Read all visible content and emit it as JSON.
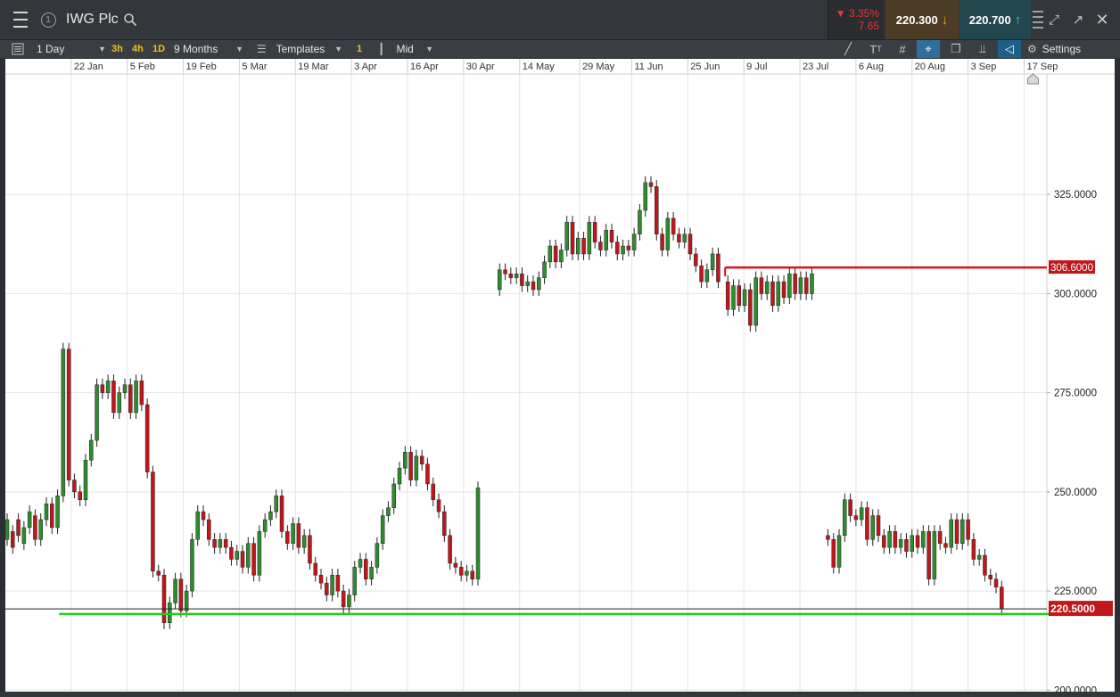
{
  "header": {
    "title": "IWG Plc",
    "change_pct": "▼ 3.35%",
    "change_abs": "7.65",
    "sell_price": "220.300",
    "buy_price": "220.700",
    "icons": [
      "menu-icon",
      "info-icon",
      "search-icon",
      "arrow-down-icon",
      "arrow-up-icon",
      "grip-icon",
      "expand-icon",
      "popout-icon",
      "close-icon"
    ]
  },
  "toolbar": {
    "interval": "1 Day",
    "timeframes": [
      "3h",
      "4h",
      "1D"
    ],
    "range": "9 Months",
    "templates": "Templates",
    "one": "1",
    "price_type": "Mid",
    "settings": "Settings"
  },
  "colors": {
    "up_candle": "#2e8b2e",
    "down_candle": "#c0171d",
    "resistance_line": "#dd1111",
    "support_line": "#22cc22",
    "price_tag": "#c0171d"
  },
  "chart_data": {
    "type": "candlestick",
    "x_tick_labels": [
      "22 Jan",
      "5 Feb",
      "19 Feb",
      "5 Mar",
      "19 Mar",
      "3 Apr",
      "16 Apr",
      "30 Apr",
      "14 May",
      "29 May",
      "11 Jun",
      "25 Jun",
      "9 Jul",
      "23 Jul",
      "6 Aug",
      "20 Aug",
      "3 Sep",
      "17 Sep"
    ],
    "y_tick_labels": [
      "325.0000",
      "300.0000",
      "275.0000",
      "250.0000",
      "225.0000",
      "200.0000"
    ],
    "y_ticks": [
      325,
      300,
      275,
      250,
      225,
      200
    ],
    "ylim": [
      194,
      350
    ],
    "grid": true,
    "horizontal_lines": [
      {
        "value": 306.6,
        "label": "306.6000",
        "color": "#dd1111",
        "from": "9 Jul"
      },
      {
        "value": 219.2,
        "color": "#22cc22",
        "from": "5 Feb"
      }
    ],
    "last_price": {
      "value": 220.5,
      "label": "220.5000"
    },
    "series": [
      {
        "name": "IWG Plc",
        "segments": [
          {
            "days": [
              [
                0,
                238,
                243
              ],
              [
                1,
                240,
                236
              ],
              [
                2,
                243,
                239
              ],
              [
                3,
                237,
                241
              ],
              [
                4,
                241,
                245
              ],
              [
                5,
                244,
                238
              ],
              [
                6,
                238,
                243
              ],
              [
                7,
                243,
                247
              ],
              [
                8,
                247,
                241
              ],
              [
                9,
                241,
                249
              ],
              [
                10,
                249,
                286
              ],
              [
                11,
                286,
                253
              ],
              [
                12,
                253,
                250
              ],
              [
                13,
                250,
                248
              ],
              [
                14,
                248,
                258
              ],
              [
                15,
                258,
                263
              ],
              [
                16,
                263,
                277
              ],
              [
                17,
                277,
                275
              ],
              [
                18,
                275,
                278
              ],
              [
                19,
                278,
                270
              ],
              [
                20,
                270,
                275
              ],
              [
                21,
                275,
                277
              ],
              [
                22,
                277,
                270
              ],
              [
                23,
                270,
                278
              ],
              [
                24,
                278,
                272
              ],
              [
                25,
                272,
                255
              ],
              [
                26,
                255,
                230
              ],
              [
                27,
                230,
                229
              ],
              [
                28,
                229,
                217
              ],
              [
                29,
                217,
                222
              ],
              [
                30,
                222,
                228
              ],
              [
                31,
                228,
                220
              ],
              [
                32,
                220,
                225
              ],
              [
                33,
                225,
                238
              ],
              [
                34,
                238,
                245
              ],
              [
                35,
                245,
                243
              ],
              [
                36,
                243,
                238
              ],
              [
                37,
                238,
                236
              ],
              [
                38,
                236,
                238
              ],
              [
                39,
                238,
                236
              ],
              [
                40,
                236,
                233
              ],
              [
                41,
                233,
                235
              ],
              [
                42,
                235,
                231
              ],
              [
                43,
                231,
                237
              ],
              [
                44,
                237,
                229
              ],
              [
                45,
                229,
                240
              ],
              [
                46,
                240,
                243
              ],
              [
                47,
                243,
                245
              ],
              [
                48,
                245,
                249
              ],
              [
                49,
                249,
                240
              ],
              [
                50,
                240,
                237
              ],
              [
                51,
                237,
                242
              ],
              [
                52,
                242,
                236
              ],
              [
                53,
                236,
                239
              ],
              [
                54,
                239,
                232
              ],
              [
                55,
                232,
                229
              ],
              [
                56,
                229,
                227
              ],
              [
                57,
                227,
                224
              ],
              [
                58,
                224,
                229
              ],
              [
                59,
                229,
                225
              ],
              [
                60,
                225,
                221
              ],
              [
                61,
                221,
                224
              ],
              [
                62,
                224,
                231
              ],
              [
                63,
                231,
                233
              ],
              [
                64,
                233,
                228
              ],
              [
                65,
                228,
                231
              ],
              [
                66,
                231,
                237
              ],
              [
                67,
                237,
                244
              ],
              [
                68,
                244,
                246
              ],
              [
                69,
                246,
                252
              ],
              [
                70,
                252,
                256
              ],
              [
                71,
                256,
                260
              ],
              [
                72,
                260,
                253
              ],
              [
                73,
                253,
                259
              ],
              [
                74,
                259,
                257
              ],
              [
                75,
                257,
                252
              ],
              [
                76,
                252,
                248
              ],
              [
                77,
                248,
                245
              ],
              [
                78,
                245,
                239
              ],
              [
                79,
                239,
                232
              ],
              [
                80,
                232,
                231
              ],
              [
                81,
                231,
                229
              ],
              [
                82,
                229,
                230
              ],
              [
                83,
                230,
                228
              ],
              [
                84,
                228,
                251
              ]
            ]
          },
          {
            "days": [
              [
                0,
                301,
                306
              ],
              [
                1,
                306,
                305
              ],
              [
                2,
                305,
                304
              ],
              [
                3,
                304,
                305
              ],
              [
                4,
                305,
                302
              ],
              [
                5,
                302,
                303
              ],
              [
                6,
                303,
                301
              ],
              [
                7,
                301,
                304
              ],
              [
                8,
                304,
                308
              ],
              [
                9,
                308,
                312
              ],
              [
                10,
                312,
                308
              ],
              [
                11,
                308,
                311
              ],
              [
                12,
                311,
                318
              ],
              [
                13,
                318,
                310
              ],
              [
                14,
                310,
                314
              ],
              [
                15,
                314,
                310
              ],
              [
                16,
                310,
                318
              ],
              [
                17,
                318,
                313
              ],
              [
                18,
                313,
                311
              ],
              [
                19,
                311,
                316
              ],
              [
                20,
                316,
                313
              ],
              [
                21,
                313,
                310
              ],
              [
                22,
                310,
                312
              ],
              [
                23,
                312,
                311
              ],
              [
                24,
                311,
                315
              ],
              [
                25,
                315,
                321
              ],
              [
                26,
                321,
                328
              ],
              [
                27,
                328,
                327
              ],
              [
                28,
                327,
                315
              ],
              [
                29,
                315,
                311
              ],
              [
                30,
                311,
                319
              ],
              [
                31,
                319,
                315
              ],
              [
                32,
                315,
                313
              ],
              [
                33,
                313,
                315
              ],
              [
                34,
                315,
                310
              ],
              [
                35,
                310,
                307
              ],
              [
                36,
                307,
                303
              ],
              [
                37,
                303,
                306
              ],
              [
                38,
                306,
                310
              ],
              [
                39,
                310,
                303
              ]
            ]
          },
          {
            "days": [
              [
                0,
                303,
                296
              ],
              [
                1,
                296,
                302
              ],
              [
                2,
                302,
                297
              ],
              [
                3,
                297,
                301
              ],
              [
                4,
                301,
                292
              ],
              [
                5,
                292,
                304
              ],
              [
                6,
                304,
                300
              ],
              [
                7,
                300,
                303
              ],
              [
                8,
                303,
                297
              ],
              [
                9,
                297,
                303
              ],
              [
                10,
                303,
                299
              ],
              [
                11,
                299,
                305
              ],
              [
                12,
                305,
                300
              ],
              [
                13,
                300,
                304
              ],
              [
                14,
                304,
                300
              ],
              [
                15,
                300,
                305
              ]
            ]
          },
          {
            "days": [
              [
                0,
                239,
                238
              ],
              [
                1,
                238,
                231
              ],
              [
                2,
                231,
                239
              ],
              [
                3,
                239,
                248
              ],
              [
                4,
                248,
                244
              ],
              [
                5,
                244,
                243
              ],
              [
                6,
                243,
                246
              ],
              [
                7,
                246,
                238
              ],
              [
                8,
                238,
                244
              ],
              [
                9,
                244,
                239
              ],
              [
                10,
                239,
                236
              ],
              [
                11,
                236,
                240
              ],
              [
                12,
                240,
                236
              ],
              [
                13,
                236,
                238
              ],
              [
                14,
                238,
                235
              ],
              [
                15,
                235,
                239
              ],
              [
                16,
                239,
                236
              ],
              [
                17,
                236,
                240
              ],
              [
                18,
                240,
                228
              ],
              [
                19,
                228,
                240
              ],
              [
                20,
                240,
                237
              ],
              [
                21,
                237,
                236
              ],
              [
                22,
                236,
                243
              ],
              [
                23,
                243,
                237
              ],
              [
                24,
                237,
                243
              ],
              [
                25,
                243,
                238
              ],
              [
                26,
                238,
                233
              ],
              [
                27,
                233,
                234
              ],
              [
                28,
                234,
                229
              ],
              [
                29,
                229,
                228
              ],
              [
                30,
                228,
                226
              ],
              [
                31,
                226,
                220.5
              ]
            ]
          }
        ]
      }
    ]
  }
}
